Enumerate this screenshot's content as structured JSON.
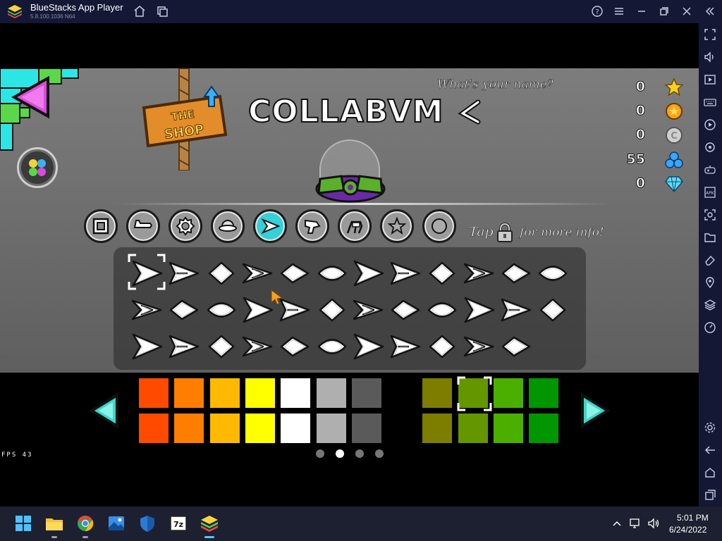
{
  "window": {
    "title": "BlueStacks App Player",
    "version": "5.8.100.1036 N64"
  },
  "titlebar_icons": [
    "home-icon",
    "multi-instance-icon",
    "help-icon",
    "menu-icon",
    "minimize-icon",
    "maximize-icon",
    "close-icon",
    "collapse-sidebar-icon"
  ],
  "sidebar_icons": [
    "fullscreen-icon",
    "volume-icon",
    "media-icon",
    "keyboard-icon",
    "record-icon",
    "rotate-icon",
    "gamepad-icon",
    "apk-icon",
    "screenshot-icon",
    "folder-icon",
    "eraser-icon",
    "location-icon",
    "layers-icon",
    "speed-icon",
    "settings-icon",
    "back-icon",
    "home-icon",
    "recents-icon"
  ],
  "game": {
    "name_prompt": "What's your name?",
    "player_name": "COLLABVM",
    "shop_label": "THE SHOP",
    "stats": [
      {
        "value": "0",
        "icon": "star-icon",
        "color": "#f7d21a"
      },
      {
        "value": "0",
        "icon": "secret-coin-icon",
        "color": "#f4a51a"
      },
      {
        "value": "0",
        "icon": "user-coin-icon",
        "color": "#cfcfcf"
      },
      {
        "value": "55",
        "icon": "orbs-icon",
        "color": "#3aa6ff"
      },
      {
        "value": "0",
        "icon": "diamond-icon",
        "color": "#5fd8ff"
      }
    ],
    "categories": [
      "cube",
      "ship",
      "ball",
      "ufo",
      "wave",
      "robot",
      "spider",
      "trail",
      "death-effect"
    ],
    "active_category": "wave",
    "tap_info_prefix": "Tap",
    "tap_info_suffix": "for more info!",
    "icon_rows": [
      12,
      12,
      11
    ],
    "selected_icon_index": 0,
    "swatches_top": [
      "#ff4a00",
      "#ff7d00",
      "#ffb900",
      "#ffff00",
      "#ffffff",
      "#afafaf",
      "#5a5a5a",
      "#000000",
      "#7d7d00",
      "#649600",
      "#4baf00",
      "#009600"
    ],
    "swatches_bottom": [
      "#ff4a00",
      "#ff7d00",
      "#ffb900",
      "#ffff00",
      "#ffffff",
      "#afafaf",
      "#5a5a5a",
      "#000000",
      "#7d7d00",
      "#649600",
      "#4baf00",
      "#009600"
    ],
    "selected_swatch_index": 9,
    "fps_label": "FPS 43",
    "page_dots": 4,
    "active_dot": 1
  },
  "taskbar": {
    "apps": [
      "windows-start-icon",
      "file-explorer-icon",
      "chrome-icon",
      "photos-icon",
      "security-icon",
      "7zip-icon",
      "bluestacks-icon"
    ],
    "time": "5:01 PM",
    "date": "6/24/2022"
  }
}
